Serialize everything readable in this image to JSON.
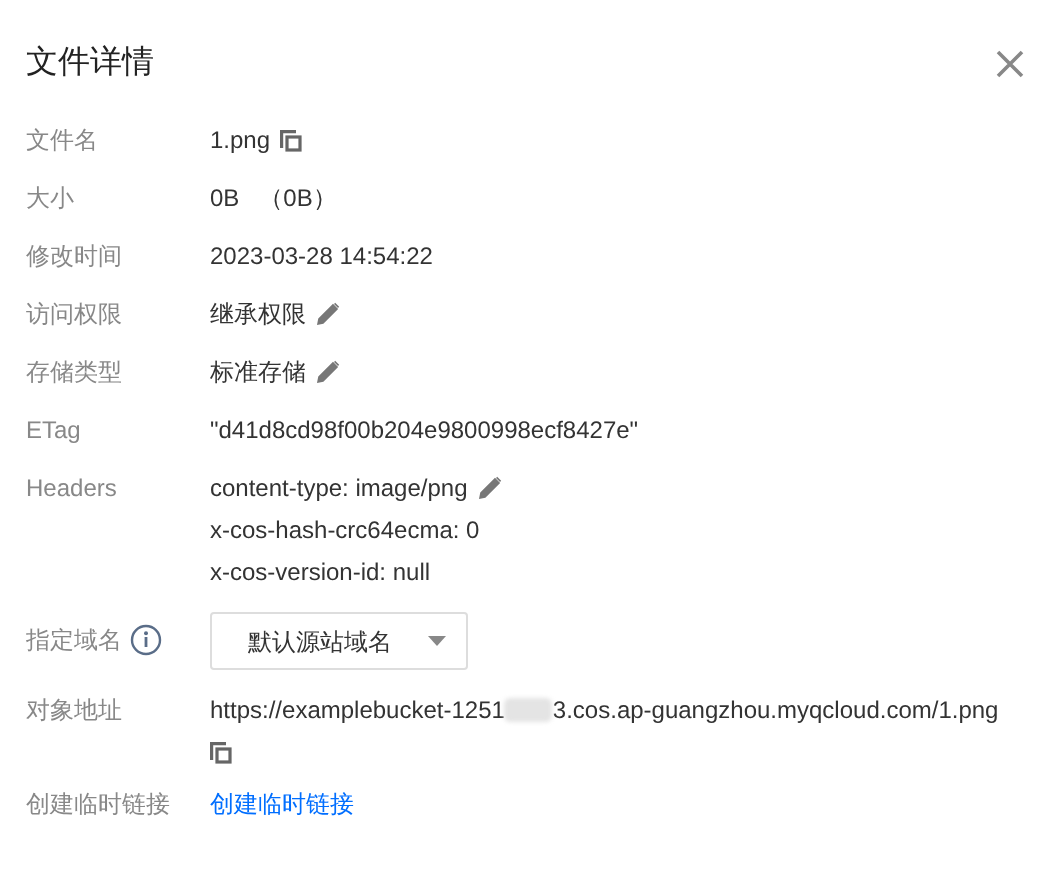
{
  "dialog": {
    "title": "文件详情"
  },
  "rows": [
    {
      "label": "文件名",
      "kind": "text",
      "value": "1.png",
      "copyable": true,
      "editable": false
    },
    {
      "label": "大小",
      "kind": "text",
      "value": "0B   （0B）",
      "copyable": false,
      "editable": false
    },
    {
      "label": "修改时间",
      "kind": "text",
      "value": "2023-03-28 14:54:22",
      "copyable": false,
      "editable": false
    },
    {
      "label": "访问权限",
      "kind": "text",
      "value": "继承权限",
      "copyable": false,
      "editable": true
    },
    {
      "label": "存储类型",
      "kind": "text",
      "value": "标准存储",
      "copyable": false,
      "editable": true
    },
    {
      "label": "ETag",
      "kind": "text",
      "value": "\"d41d8cd98f00b204e9800998ecf8427e\"",
      "copyable": false,
      "editable": false
    },
    {
      "label": "Headers",
      "kind": "lines",
      "lines": [
        {
          "text": "content-type: image/png",
          "editable": true
        },
        {
          "text": "x-cos-hash-crc64ecma: 0",
          "editable": false
        },
        {
          "text": "x-cos-version-id: null",
          "editable": false
        }
      ]
    },
    {
      "label": "指定域名",
      "kind": "select",
      "info": true,
      "value": "默认源站域名"
    },
    {
      "label": "对象地址",
      "kind": "url",
      "value_start": "https://examplebucket-1251",
      "value_end": "3.cos.ap-guangzhou.myqcloud.com/1.png",
      "copyable": true
    },
    {
      "label": "创建临时链接",
      "kind": "link",
      "value": "创建临时链接"
    }
  ]
}
